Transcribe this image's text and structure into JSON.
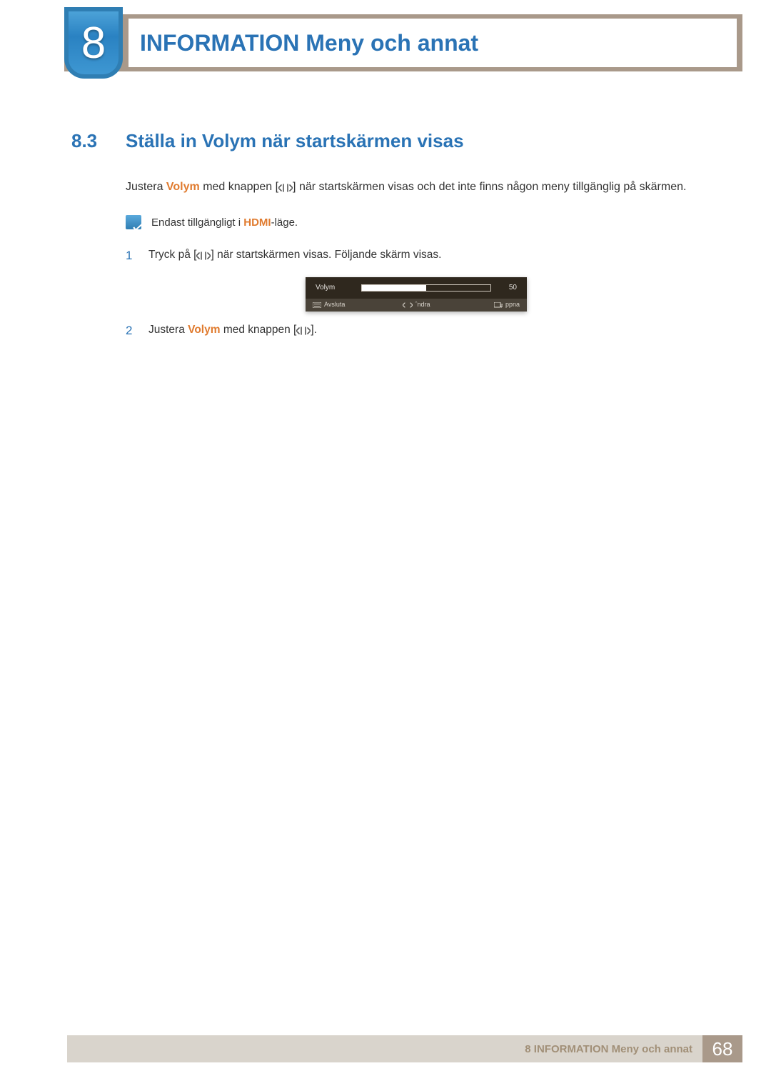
{
  "header": {
    "chapter_number": "8",
    "chapter_title": "INFORMATION Meny och annat"
  },
  "section": {
    "number": "8.3",
    "title": "Ställa in Volym när startskärmen visas"
  },
  "intro": {
    "pre": "Justera ",
    "strong": "Volym",
    "mid": " med knappen [",
    "post": "] när startskärmen visas och det inte finns någon meny tillgänglig på skärmen."
  },
  "note": {
    "pre": "Endast tillgängligt i ",
    "strong": "HDMI",
    "post": "-läge."
  },
  "steps": [
    {
      "num": "1",
      "pre": "Tryck på [",
      "post": "] när startskärmen visas. Följande skärm visas."
    },
    {
      "num": "2",
      "pre": "Justera ",
      "strong": "Volym",
      "mid": " med knappen [",
      "post": "]."
    }
  ],
  "osd": {
    "label": "Volym",
    "value": "50",
    "fill_percent": 50,
    "bottom": {
      "exit": "Avsluta",
      "adjust": "ˆndra",
      "open": "ppna"
    }
  },
  "footer": {
    "text": "8 INFORMATION Meny och annat",
    "page": "68"
  }
}
